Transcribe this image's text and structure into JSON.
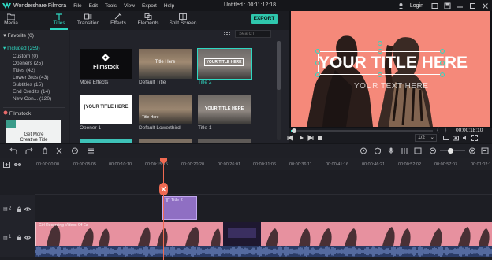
{
  "app": {
    "name": "Wondershare Filmora",
    "menu": [
      "File",
      "Edit",
      "Tools",
      "View",
      "Export",
      "Help"
    ],
    "document_title": "Untitled : 00:11:12:18",
    "login_label": "Login"
  },
  "toolbar": {
    "tabs": [
      {
        "label": "Media",
        "icon": "folder-icon"
      },
      {
        "label": "Titles",
        "icon": "text-icon",
        "active": true
      },
      {
        "label": "Transition",
        "icon": "transition-icon"
      },
      {
        "label": "Effects",
        "icon": "effects-icon"
      },
      {
        "label": "Elements",
        "icon": "elements-icon"
      },
      {
        "label": "Split Screen",
        "icon": "split-screen-icon"
      }
    ],
    "export_label": "EXPORT"
  },
  "sidebar": {
    "favorite_label": "Favorite (0)",
    "group_label": "Included (259)",
    "items": [
      {
        "label": "Custom (0)"
      },
      {
        "label": "Openers (25)"
      },
      {
        "label": "Titles (42)"
      },
      {
        "label": "Lower 3rds (43)"
      },
      {
        "label": "Subtitles (15)"
      },
      {
        "label": "End Credits (14)"
      },
      {
        "label": "New Con... (120)"
      }
    ],
    "filmstock_label": "Filmstock",
    "ad_text_line1": "Get More",
    "ad_text_line2": "Creative Title"
  },
  "browser": {
    "search_placeholder": "Search",
    "cards": [
      {
        "label": "More Effects",
        "thumb_text": "Filmstock"
      },
      {
        "label": "Default Title",
        "thumb_text": "Title Here"
      },
      {
        "label": "Title 2",
        "thumb_text": "YOUR TITLE HERE",
        "selected": true
      },
      {
        "label": "Opener 1",
        "thumb_text": "|YOUR TITLE HERE"
      },
      {
        "label": "Default Lowerthird",
        "thumb_text": "Title Here"
      },
      {
        "label": "Title 1",
        "thumb_text": "YOUR TITLE HERE"
      }
    ]
  },
  "preview": {
    "title_text": "YOUR TITLE HERE",
    "subtitle_text": "YOUR TEXT HERE",
    "timecode": "00:00:18:10",
    "page_select": "1/2",
    "progress": 0.02
  },
  "timeline": {
    "ruler_ticks": [
      "00:00:00:00",
      "00:00:05:05",
      "00:00:10:10",
      "00:00:15:15",
      "00:00:20:20",
      "00:00:26:01",
      "00:00:31:06",
      "00:00:36:11",
      "00:00:41:16",
      "00:00:46:21",
      "00:00:52:02",
      "00:00:57:07",
      "00:01:02:1"
    ],
    "title_clip_label": "Title 2",
    "track2_number": "2",
    "track1_number": "1",
    "video_clip_label": "Girl Recording Videos Of Ea"
  },
  "colors": {
    "accent": "#2fd8c2",
    "export": "#2fc7ad",
    "playhead": "#f06a52",
    "title_clip": "#8f6fc3",
    "preview_bg": "#f5897a"
  }
}
